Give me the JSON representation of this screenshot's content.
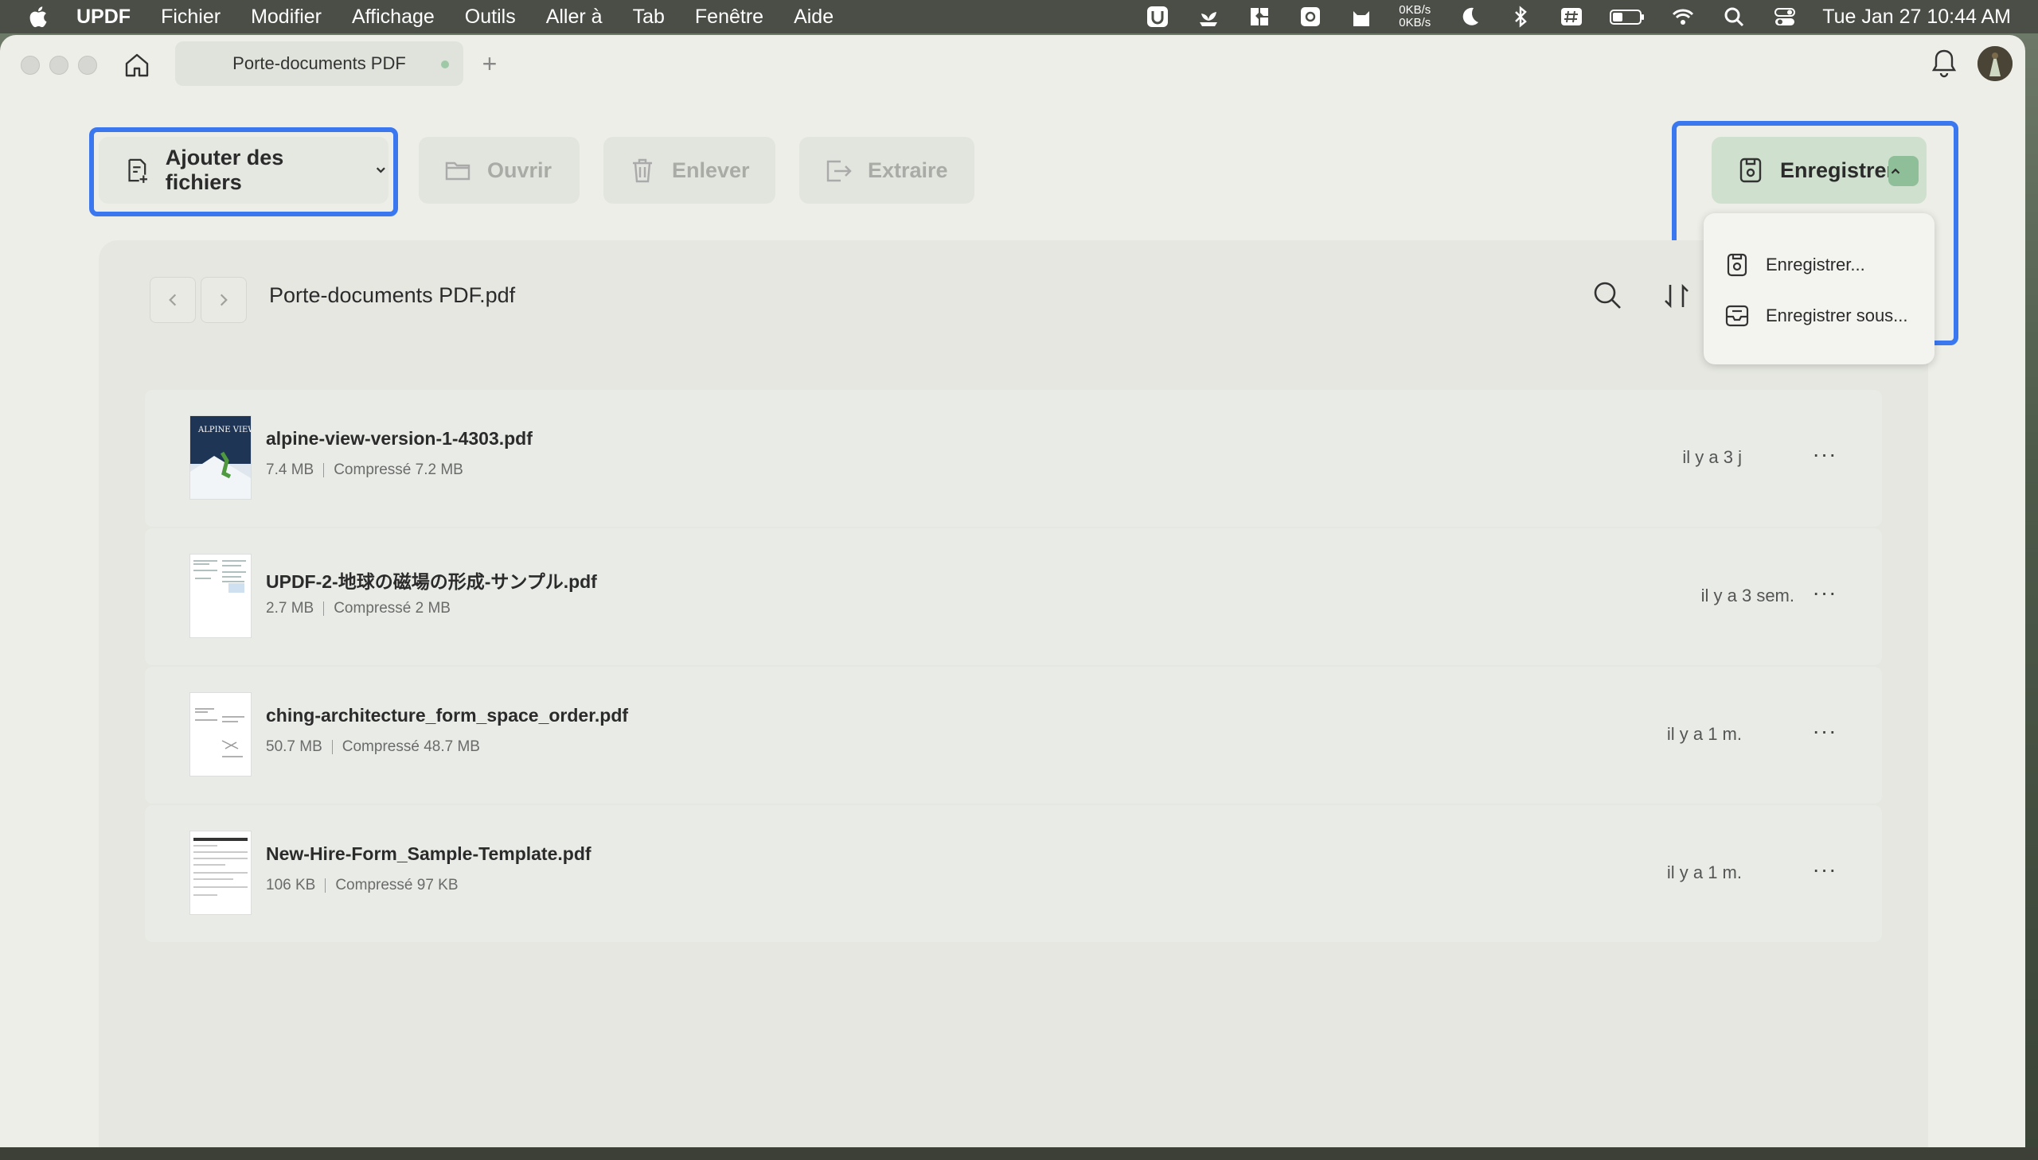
{
  "menubar": {
    "app_name": "UPDF",
    "items": [
      "Fichier",
      "Modifier",
      "Affichage",
      "Outils",
      "Aller à",
      "Tab",
      "Fenêtre",
      "Aide"
    ],
    "net_up": "0KB/s",
    "net_down": "0KB/s",
    "clock": "Tue Jan 27  10:44 AM"
  },
  "tab": {
    "title": "Porte-documents PDF"
  },
  "toolbar": {
    "add_files": "Ajouter des fichiers",
    "open": "Ouvrir",
    "remove": "Enlever",
    "extract": "Extraire",
    "save": "Enregistrer"
  },
  "save_menu": {
    "save": "Enregistrer...",
    "save_as": "Enregistrer sous..."
  },
  "panel": {
    "title": "Porte-documents PDF.pdf"
  },
  "files": [
    {
      "name": "alpine-view-version-1-4303.pdf",
      "size": "7.4 MB",
      "compressed": "Compressé 7.2 MB",
      "date": "il y a 3 j",
      "thumb_text": "ALPINE VIEW"
    },
    {
      "name": "UPDF-2-地球の磁場の形成-サンプル.pdf",
      "size": "2.7 MB",
      "compressed": "Compressé 2 MB",
      "date": "il y a 3 sem."
    },
    {
      "name": "ching-architecture_form_space_order.pdf",
      "size": "50.7 MB",
      "compressed": "Compressé 48.7 MB",
      "date": "il y a 1 m."
    },
    {
      "name": "New-Hire-Form_Sample-Template.pdf",
      "size": "106 KB",
      "compressed": "Compressé 97 KB",
      "date": "il y a 1 m."
    }
  ],
  "more_glyph": "···",
  "colors": {
    "highlight": "#3b78f0",
    "accent_green": "#8fbf98"
  }
}
